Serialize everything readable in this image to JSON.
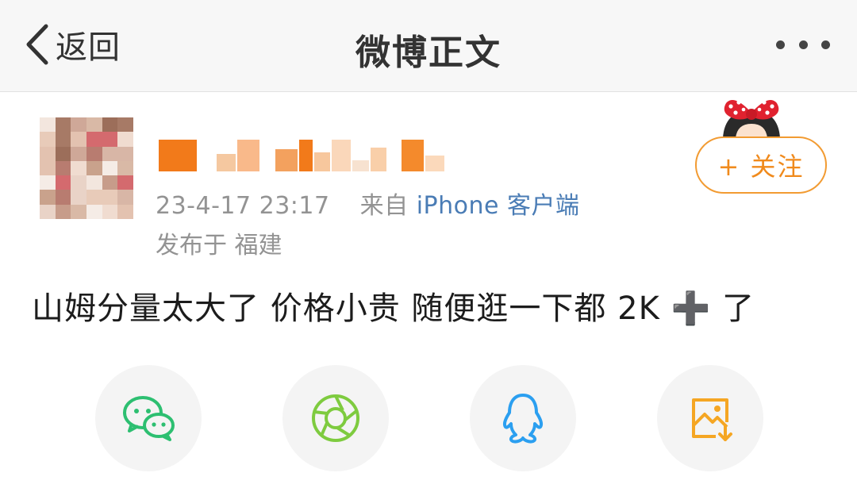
{
  "nav": {
    "back_label": "返回",
    "title": "微博正文",
    "more_icon": "more-dots-icon"
  },
  "post": {
    "timestamp": "23-4-17 23:17",
    "source_prefix": "来自",
    "source": "iPhone 客户端",
    "location": "发布于 福建",
    "follow_label": "+ 关注",
    "text": "山姆分量太大了  价格小贵  随便逛一下都 2K ➕ 了"
  },
  "share": [
    {
      "name": "wechat",
      "icon": "wechat-icon"
    },
    {
      "name": "moments",
      "icon": "moments-icon"
    },
    {
      "name": "qq",
      "icon": "qq-icon"
    },
    {
      "name": "save-image",
      "icon": "save-image-icon"
    }
  ],
  "colors": {
    "accent_orange": "#f08a1c",
    "link_blue": "#4a7cb5",
    "wechat_green": "#2dbf71",
    "moments_green": "#7ecb3f",
    "qq_blue": "#2b9ff0",
    "save_orange": "#f5a623"
  }
}
